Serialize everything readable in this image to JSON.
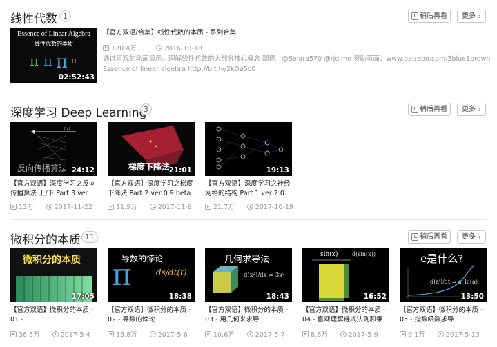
{
  "sections": [
    {
      "title": "线性代数",
      "count": "1",
      "watch_later": "稍后再看",
      "more": "更多",
      "video": {
        "thumb_text_line1": "Essence of Linear Algebra",
        "thumb_text_line2": "线性代数的本质",
        "duration": "02:52:43",
        "title": "【官方双语/合集】线性代数的本质 - 系列合集",
        "views": "120.4万",
        "date": "2016-10-18",
        "desc_line1": "通过直观的动画演示，理解线性代数的大部分核心概念 翻译：@Solara570 @rjdimo 资助页面：www.patreon.com/3blue1brown",
        "desc_line2": "Essence of linear algebra http://bit.ly/2kDa5o0"
      }
    },
    {
      "title": "深度学习 Deep Learning",
      "count": "3",
      "watch_later": "稍后再看",
      "more": "更多",
      "videos": [
        {
          "thumb_text": "反向传播算法",
          "thumb_label": "f(x)",
          "duration": "24:12",
          "title": "【官方双语】深度学习之反向传播算法 上/下 Part 3 ver",
          "views": "13万",
          "date": "2017-11-22"
        },
        {
          "thumb_text": "梯度下降法",
          "duration": "21:01",
          "title": "【官方双语】深度学习之梯度下降法 Part 2 ver 0.9 beta",
          "views": "11.9万",
          "date": "2017-11-8"
        },
        {
          "duration": "19:13",
          "title": "【官方双语】深度学习之神经网络的结构 Part 1 ver 2.0",
          "views": "21.7万",
          "date": "2017-10-19"
        }
      ]
    },
    {
      "title": "微积分的本质",
      "count": "11",
      "watch_later": "稍后再看",
      "more": "更多",
      "videos": [
        {
          "thumb_text": "微积分的本质",
          "duration": "17:05",
          "title": "【官方双语】微积分的本质 - 01 -",
          "views": "36.5万",
          "date": "2017-5-4"
        },
        {
          "thumb_text": "导数的悖论",
          "thumb_formula": "ds/dt(t)",
          "duration": "18:38",
          "title": "【官方双语】微积分的本质 - 02 - 导数的悖论",
          "views": "13.8万",
          "date": "2017-5-6"
        },
        {
          "thumb_text": "几何求导法",
          "thumb_formula": "d(x³)/dx = 3x²",
          "duration": "18:43",
          "title": "【官方双语】微积分的本质 - 03 - 用几何来求导",
          "views": "10.6万",
          "date": "2017-5-7"
        },
        {
          "thumb_text": "sin(x)",
          "thumb_formula": "d(sin(x))",
          "duration": "16:52",
          "title": "【官方双语】微积分的本质 - 04 - 直观理解链式法则和乘",
          "views": "8.6万",
          "date": "2017-5-9"
        },
        {
          "thumb_text": "e是什么?",
          "thumb_formula": "d(aᵗ)/dt = aᵗ ln(a)",
          "duration": "13:50",
          "title": "【官方双语】微积分的本质 - 05 - 指数函数求导",
          "views": "9.1万",
          "date": "2017-5-13"
        }
      ]
    }
  ]
}
